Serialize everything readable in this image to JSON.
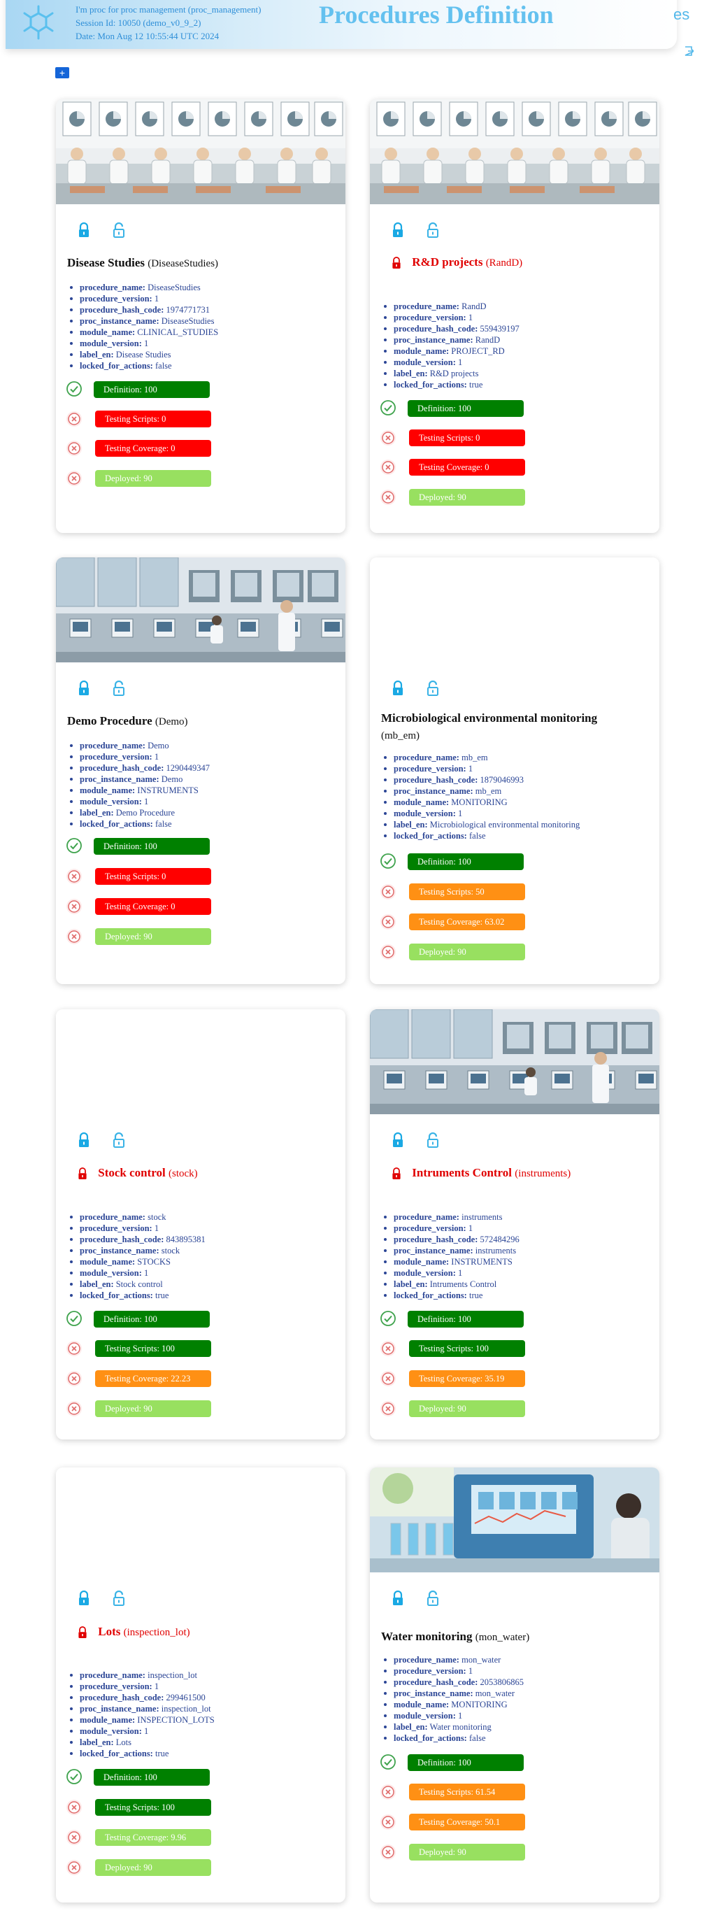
{
  "header": {
    "info_line1": "I'm proc for proc management (proc_management)",
    "info_line2": "Session Id: 10050 (demo_v0_9_2)",
    "info_line3": "Date: Mon Aug 12 10:55:44 UTC 2024",
    "title": "Procedures Definition",
    "language": "es"
  },
  "colors": {
    "accent": "#64c1ef",
    "definition": "#008000",
    "fail": "#ff0000",
    "partial": "#ff9014",
    "deployed": "#98e060",
    "locked_title": "#e00000",
    "prop_text": "#2c4696"
  },
  "icons": {
    "add": "add-square-icon",
    "lock": "lock-icon",
    "unlock": "unlock-icon",
    "check": "check-circle-icon",
    "cross": "x-circle-icon"
  },
  "procedures": [
    {
      "title": "Disease Studies",
      "code": "(DiseaseStudies)",
      "locked": false,
      "props": [
        {
          "k": "procedure_name:",
          "v": "DiseaseStudies"
        },
        {
          "k": "procedure_version:",
          "v": "1"
        },
        {
          "k": "procedure_hash_code:",
          "v": "1974771731"
        },
        {
          "k": "proc_instance_name:",
          "v": "DiseaseStudies"
        },
        {
          "k": "module_name:",
          "v": "CLINICAL_STUDIES"
        },
        {
          "k": "module_version:",
          "v": "1"
        },
        {
          "k": "label_en:",
          "v": "Disease Studies"
        },
        {
          "k": "locked_for_actions:",
          "v": "false"
        }
      ],
      "definition": "Definition: 100",
      "scripts": "Testing Scripts: 0",
      "coverage": "Testing Coverage: 0",
      "deployed": "Deployed: 90"
    },
    {
      "title": "R&D projects",
      "code": "(RandD)",
      "locked": true,
      "props": [
        {
          "k": "procedure_name:",
          "v": "RandD"
        },
        {
          "k": "procedure_version:",
          "v": "1"
        },
        {
          "k": "procedure_hash_code:",
          "v": "559439197"
        },
        {
          "k": "proc_instance_name:",
          "v": "RandD"
        },
        {
          "k": "module_name:",
          "v": "PROJECT_RD"
        },
        {
          "k": "module_version:",
          "v": "1"
        },
        {
          "k": "label_en:",
          "v": "R&D projects"
        },
        {
          "k": "locked_for_actions:",
          "v": "true"
        }
      ],
      "definition": "Definition: 100",
      "scripts": "Testing Scripts: 0",
      "coverage": "Testing Coverage: 0",
      "deployed": "Deployed: 90"
    },
    {
      "title": "Demo Procedure",
      "code": "(Demo)",
      "locked": false,
      "props": [
        {
          "k": "procedure_name:",
          "v": "Demo"
        },
        {
          "k": "procedure_version:",
          "v": "1"
        },
        {
          "k": "procedure_hash_code:",
          "v": "1290449347"
        },
        {
          "k": "proc_instance_name:",
          "v": "Demo"
        },
        {
          "k": "module_name:",
          "v": "INSTRUMENTS"
        },
        {
          "k": "module_version:",
          "v": "1"
        },
        {
          "k": "label_en:",
          "v": "Demo Procedure"
        },
        {
          "k": "locked_for_actions:",
          "v": "false"
        }
      ],
      "definition": "Definition: 100",
      "scripts": "Testing Scripts: 0",
      "coverage": "Testing Coverage: 0",
      "deployed": "Deployed: 90"
    },
    {
      "title": "Microbiological environmental monitoring",
      "code": "(mb_em)",
      "locked": false,
      "props": [
        {
          "k": "procedure_name:",
          "v": "mb_em"
        },
        {
          "k": "procedure_version:",
          "v": "1"
        },
        {
          "k": "procedure_hash_code:",
          "v": "1879046993"
        },
        {
          "k": "proc_instance_name:",
          "v": "mb_em"
        },
        {
          "k": "module_name:",
          "v": "MONITORING"
        },
        {
          "k": "module_version:",
          "v": "1"
        },
        {
          "k": "label_en:",
          "v": "Microbiological environmental monitoring"
        },
        {
          "k": "locked_for_actions:",
          "v": "false"
        }
      ],
      "definition": "Definition: 100",
      "scripts": "Testing Scripts: 50",
      "coverage": "Testing Coverage: 63.02",
      "deployed": "Deployed: 90"
    },
    {
      "title": "Stock control",
      "code": "(stock)",
      "locked": true,
      "props": [
        {
          "k": "procedure_name:",
          "v": "stock"
        },
        {
          "k": "procedure_version:",
          "v": "1"
        },
        {
          "k": "procedure_hash_code:",
          "v": "843895381"
        },
        {
          "k": "proc_instance_name:",
          "v": "stock"
        },
        {
          "k": "module_name:",
          "v": "STOCKS"
        },
        {
          "k": "module_version:",
          "v": "1"
        },
        {
          "k": "label_en:",
          "v": "Stock control"
        },
        {
          "k": "locked_for_actions:",
          "v": "true"
        }
      ],
      "definition": "Definition: 100",
      "scripts": "Testing Scripts: 100",
      "coverage": "Testing Coverage: 22.23",
      "deployed": "Deployed: 90"
    },
    {
      "title": "Intruments Control",
      "code": "(instruments)",
      "locked": true,
      "props": [
        {
          "k": "procedure_name:",
          "v": "instruments"
        },
        {
          "k": "procedure_version:",
          "v": "1"
        },
        {
          "k": "procedure_hash_code:",
          "v": "572484296"
        },
        {
          "k": "proc_instance_name:",
          "v": "instruments"
        },
        {
          "k": "module_name:",
          "v": "INSTRUMENTS"
        },
        {
          "k": "module_version:",
          "v": "1"
        },
        {
          "k": "label_en:",
          "v": "Intruments Control"
        },
        {
          "k": "locked_for_actions:",
          "v": "true"
        }
      ],
      "definition": "Definition: 100",
      "scripts": "Testing Scripts: 100",
      "coverage": "Testing Coverage: 35.19",
      "deployed": "Deployed: 90"
    },
    {
      "title": "Lots",
      "code": "(inspection_lot)",
      "locked": true,
      "props": [
        {
          "k": "procedure_name:",
          "v": "inspection_lot"
        },
        {
          "k": "procedure_version:",
          "v": "1"
        },
        {
          "k": "procedure_hash_code:",
          "v": "299461500"
        },
        {
          "k": "proc_instance_name:",
          "v": "inspection_lot"
        },
        {
          "k": "module_name:",
          "v": "INSPECTION_LOTS"
        },
        {
          "k": "module_version:",
          "v": "1"
        },
        {
          "k": "label_en:",
          "v": "Lots"
        },
        {
          "k": "locked_for_actions:",
          "v": "true"
        }
      ],
      "definition": "Definition: 100",
      "scripts": "Testing Scripts: 100",
      "coverage": "Testing Coverage: 9.96",
      "deployed": "Deployed: 90"
    },
    {
      "title": "Water monitoring",
      "code": "(mon_water)",
      "locked": false,
      "props": [
        {
          "k": "procedure_name:",
          "v": "mon_water"
        },
        {
          "k": "procedure_version:",
          "v": "1"
        },
        {
          "k": "procedure_hash_code:",
          "v": "2053806865"
        },
        {
          "k": "proc_instance_name:",
          "v": "mon_water"
        },
        {
          "k": "module_name:",
          "v": "MONITORING"
        },
        {
          "k": "module_version:",
          "v": "1"
        },
        {
          "k": "label_en:",
          "v": "Water monitoring"
        },
        {
          "k": "locked_for_actions:",
          "v": "false"
        }
      ],
      "definition": "Definition: 100",
      "scripts": "Testing Scripts: 61.54",
      "coverage": "Testing Coverage: 50.1",
      "deployed": "Deployed: 90"
    }
  ]
}
